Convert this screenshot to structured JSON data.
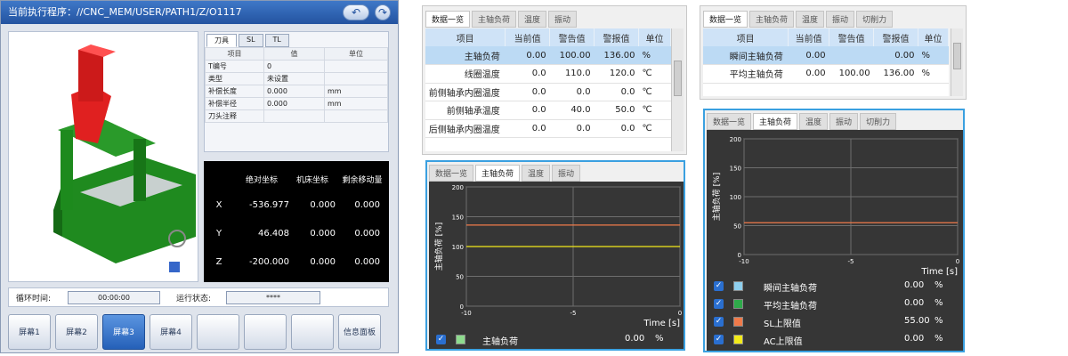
{
  "panel1": {
    "title": "当前执行程序：//CNC_MEM/USER/PATH1/Z/O1117",
    "back_icon": "back-arrow-icon",
    "forward_icon": "forward-arrow-icon",
    "tool_tabs": [
      "刀具",
      "SL",
      "TL"
    ],
    "tool_headers": [
      "项目",
      "值",
      "单位"
    ],
    "tool_rows": [
      {
        "item": "T编号",
        "value": "0",
        "unit": ""
      },
      {
        "item": "类型",
        "value": "未设置",
        "unit": ""
      },
      {
        "item": "补偿长度",
        "value": "0.000",
        "unit": "mm"
      },
      {
        "item": "补偿半径",
        "value": "0.000",
        "unit": "mm"
      },
      {
        "item": "刀头注释",
        "value": "",
        "unit": ""
      }
    ],
    "coord_headers": [
      "绝对坐标",
      "机床坐标",
      "剩余移动量"
    ],
    "coord_rows": [
      {
        "axis": "X",
        "abs": "-536.977",
        "mach": "0.000",
        "remain": "0.000"
      },
      {
        "axis": "Y",
        "abs": "46.408",
        "mach": "0.000",
        "remain": "0.000"
      },
      {
        "axis": "Z",
        "abs": "-200.000",
        "mach": "0.000",
        "remain": "0.000"
      }
    ],
    "cycle_label": "循环时间:",
    "cycle_value": "00:00:00",
    "run_label": "运行状态:",
    "run_value": "****",
    "soft_buttons": [
      "屏幕1",
      "屏幕2",
      "屏幕3",
      "屏幕4",
      "",
      "",
      "",
      "信息面板"
    ],
    "active_button": "屏幕3"
  },
  "panel2": {
    "tabs": [
      "数据一览",
      "主轴负荷",
      "温度",
      "振动"
    ],
    "headers": [
      "项目",
      "当前值",
      "警告值",
      "警报值",
      "单位"
    ],
    "rows": [
      {
        "item": "主轴负荷",
        "cur": "0.00",
        "warn": "100.00",
        "alarm": "136.00",
        "unit": "%"
      },
      {
        "item": "线圈温度",
        "cur": "0.0",
        "warn": "110.0",
        "alarm": "120.0",
        "unit": "℃"
      },
      {
        "item": "前侧轴承内圈温度",
        "cur": "0.0",
        "warn": "0.0",
        "alarm": "0.0",
        "unit": "℃"
      },
      {
        "item": "前侧轴承温度",
        "cur": "0.0",
        "warn": "40.0",
        "alarm": "50.0",
        "unit": "℃"
      },
      {
        "item": "后侧轴承内圈温度",
        "cur": "0.0",
        "warn": "0.0",
        "alarm": "0.0",
        "unit": "℃"
      }
    ],
    "chart_tabs": [
      "数据一览",
      "主轴负荷",
      "温度",
      "振动"
    ],
    "legend": {
      "label": "主轴负荷",
      "value": "0.00",
      "unit": "%"
    }
  },
  "panel3": {
    "tabs": [
      "数据一览",
      "主轴负荷",
      "温度",
      "振动",
      "切削力"
    ],
    "headers": [
      "项目",
      "当前值",
      "警告值",
      "警报值",
      "单位"
    ],
    "rows": [
      {
        "item": "瞬间主轴负荷",
        "cur": "0.00",
        "warn": "",
        "alarm": "0.00",
        "unit": "%"
      },
      {
        "item": "平均主轴负荷",
        "cur": "0.00",
        "warn": "100.00",
        "alarm": "136.00",
        "unit": "%"
      }
    ],
    "chart_tabs": [
      "数据一览",
      "主轴负荷",
      "温度",
      "振动",
      "切削力"
    ],
    "legend": [
      {
        "label": "瞬间主轴负荷",
        "value": "0.00",
        "unit": "%",
        "color": "#8ecfee"
      },
      {
        "label": "平均主轴负荷",
        "value": "0.00",
        "unit": "%",
        "color": "#2eaa4a"
      },
      {
        "label": "SL上限值",
        "value": "55.00",
        "unit": "%",
        "color": "#f07a4a"
      },
      {
        "label": "AC上限值",
        "value": "0.00",
        "unit": "%",
        "color": "#f2ea1a"
      }
    ]
  },
  "chart_data": [
    {
      "type": "line",
      "ylabel": "主轴负荷 [%]",
      "xlabel": "Time [s]",
      "xlim": [
        -10,
        0
      ],
      "ylim": [
        0,
        200
      ],
      "xticks": [
        "-10",
        "-5",
        "0"
      ],
      "yticks": [
        "0",
        "50",
        "100",
        "150",
        "200"
      ],
      "grid": true,
      "series": [
        {
          "x": [
            -10,
            0
          ],
          "y": [
            136,
            136
          ],
          "color": "#f07a4a"
        },
        {
          "x": [
            -10,
            0
          ],
          "y": [
            100,
            100
          ],
          "color": "#f2ea1a"
        }
      ]
    },
    {
      "type": "line",
      "ylabel": "主轴负荷 [%]",
      "xlabel": "Time [s]",
      "xlim": [
        -10,
        0
      ],
      "ylim": [
        0,
        200
      ],
      "xticks": [
        "-10",
        "-5",
        "0"
      ],
      "yticks": [
        "0",
        "50",
        "100",
        "150",
        "200"
      ],
      "grid": true,
      "series": [
        {
          "x": [
            -10,
            0
          ],
          "y": [
            55,
            55
          ],
          "color": "#f07a4a"
        }
      ]
    }
  ]
}
